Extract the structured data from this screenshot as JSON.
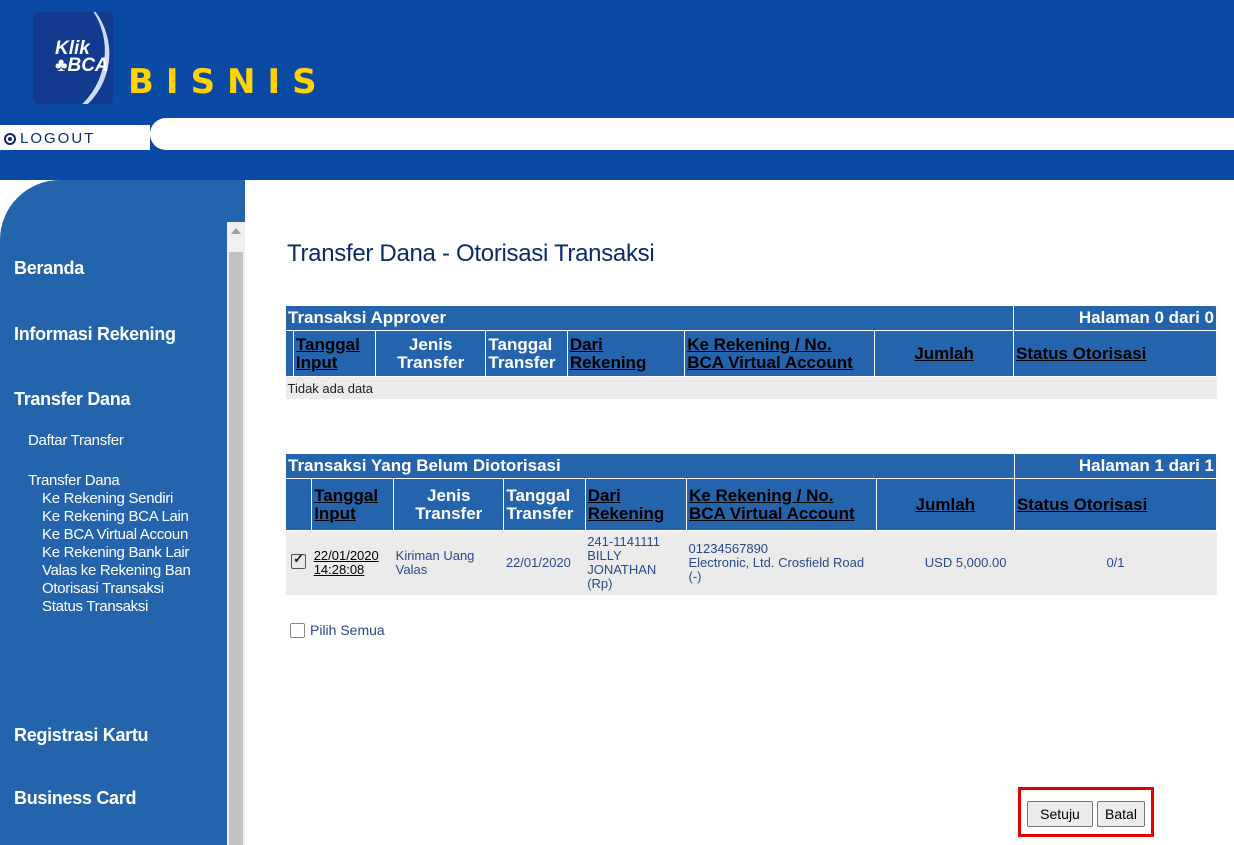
{
  "header": {
    "logo_line1": "Klik",
    "logo_line2": "♣BCA",
    "product": "BISNIS",
    "logout_label": "LOGOUT"
  },
  "sidebar": {
    "beranda": "Beranda",
    "informasi_rekening": "Informasi Rekening",
    "transfer_dana": "Transfer Dana",
    "daftar_transfer": "Daftar Transfer",
    "transfer_dana_sub": "Transfer Dana",
    "ke_rekening_sendiri": "Ke Rekening Sendiri",
    "ke_rekening_bca_lain": "Ke Rekening BCA Lain",
    "ke_bca_virtual_account": "Ke BCA Virtual Accoun",
    "ke_rekening_bank_lain": "Ke Rekening Bank Lair",
    "valas_ke_rekening_bank": "Valas ke Rekening Ban",
    "otorisasi_transaksi": "Otorisasi Transaksi",
    "status_transaksi": "Status Transaksi",
    "registrasi_kartu": "Registrasi Kartu",
    "business_card": "Business Card"
  },
  "page_title": "Transfer Dana - Otorisasi Transaksi",
  "columns": {
    "tanggal_input": "Tanggal Input",
    "jenis_transfer": "Jenis Transfer",
    "tanggal_transfer": "Tanggal Transfer",
    "dari_rekening": "Dari Rekening",
    "ke_rekening": "Ke Rekening / No. BCA Virtual Account",
    "jumlah": "Jumlah",
    "status_otorisasi": "Status Otorisasi"
  },
  "approver_table": {
    "title": "Transaksi Approver",
    "paging": "Halaman 0 dari 0",
    "empty_text": "Tidak ada data"
  },
  "pending_table": {
    "title": "Transaksi Yang Belum Diotorisasi",
    "paging": "Halaman 1 dari 1",
    "row": {
      "checked": true,
      "tanggal_input_date": "22/01/2020",
      "tanggal_input_time": "14:28:08",
      "jenis_transfer": "Kiriman Uang Valas",
      "tanggal_transfer": "22/01/2020",
      "dari_rekening_no": "241-1141111",
      "dari_rekening_name": "BILLY JONATHAN (Rp)",
      "ke_rekening_no": "01234567890",
      "ke_rekening_name": "Electronic, Ltd. Crosfield Road (-)",
      "jumlah": "USD 5,000.00",
      "status_otorisasi": "0/1"
    }
  },
  "select_all_label": "Pilih Semua",
  "buttons": {
    "approve": "Setuju",
    "cancel": "Batal"
  },
  "colors": {
    "header_blue": "#0a4aa4",
    "sidebar_blue": "#2464ac",
    "title_navy": "#0a2a6a",
    "highlight_red": "#e20000",
    "brand_yellow": "#ffd200"
  }
}
